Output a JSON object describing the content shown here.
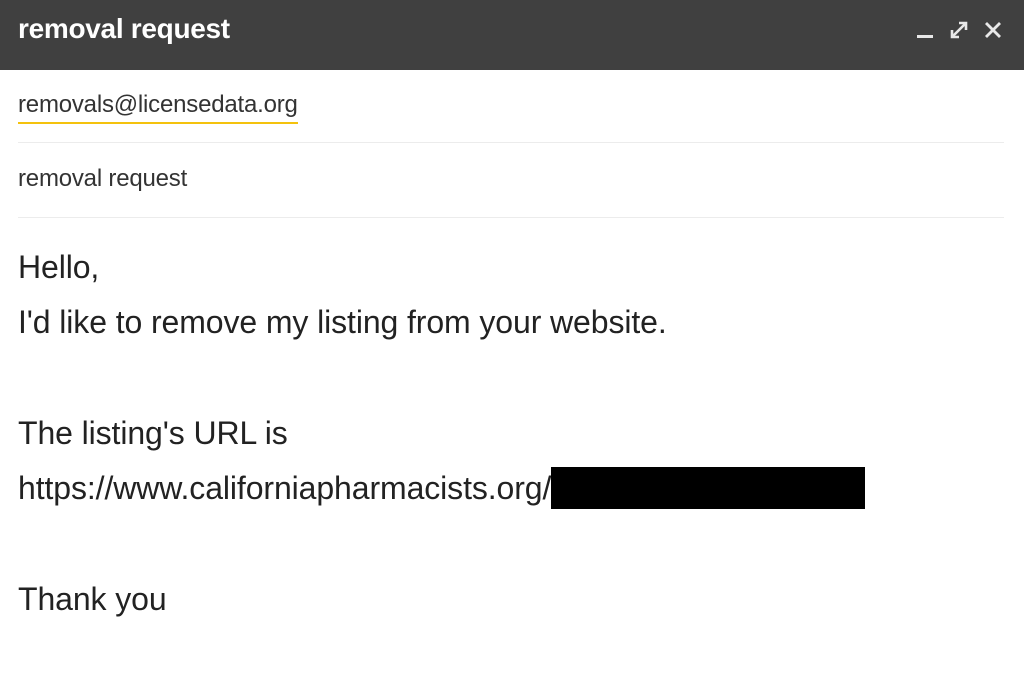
{
  "window": {
    "title": "removal request",
    "controls": {
      "minimize_icon": "minimize-icon",
      "expand_icon": "expand-icon",
      "close_icon": "close-icon"
    }
  },
  "fields": {
    "to": "removals@licensedata.org",
    "subject": "removal request"
  },
  "body": {
    "greeting": "Hello,",
    "line1": "I'd like to remove my listing from your website.",
    "line2": "The listing's URL is",
    "url": "https://www.californiapharmacists.org/",
    "closing": "Thank you"
  },
  "colors": {
    "title_bar": "#404040",
    "recipient_underline": "#f4c20d",
    "redaction": "#000000"
  }
}
